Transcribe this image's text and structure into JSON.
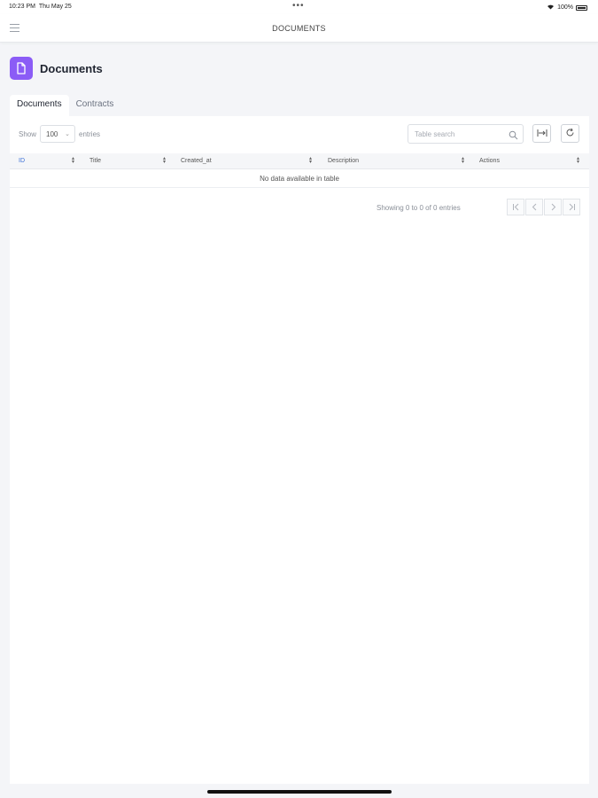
{
  "status_bar": {
    "time": "10:23 PM",
    "date": "Thu May 25",
    "multitask_dots": "•••",
    "battery": "100%",
    "wifi_icon": "wifi-icon",
    "battery_icon": "battery-icon"
  },
  "nav": {
    "title": "DOCUMENTS",
    "menu_icon": "hamburger-menu-icon"
  },
  "page": {
    "title": "Documents",
    "icon": "document-icon",
    "accent_color": "#8b5cf6"
  },
  "tabs": [
    {
      "label": "Documents",
      "active": true
    },
    {
      "label": "Contracts",
      "active": false
    }
  ],
  "table_controls": {
    "show_label": "Show",
    "page_size": "100",
    "entries_label": "entries",
    "search_placeholder": "Table search",
    "export_icon": "export-icon",
    "refresh_icon": "refresh-icon"
  },
  "table": {
    "columns": [
      "ID",
      "Title",
      "Created_at",
      "Description",
      "Actions"
    ],
    "empty_message": "No data available in table"
  },
  "pagination": {
    "info": "Showing 0 to 0 of 0 entries",
    "first": "|<",
    "prev": "<",
    "next": ">",
    "last": ">|"
  }
}
